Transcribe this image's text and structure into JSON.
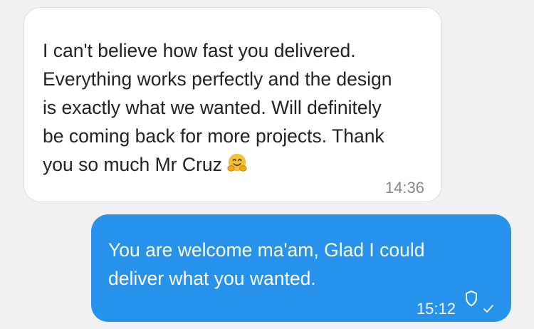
{
  "colors": {
    "background": "#f1f1f3",
    "incoming_bubble": "#ffffff",
    "outgoing_bubble": "#2792ec",
    "incoming_text": "#222222",
    "outgoing_text": "#ffffff",
    "timestamp_incoming": "#888888"
  },
  "messages": [
    {
      "direction": "incoming",
      "lines": [
        "I can't believe how fast you delivered.",
        "Everything works perfectly and the design",
        "is exactly what we wanted. Will definitely",
        "be coming back for more projects. Thank",
        "you so much Mr Cruz"
      ],
      "emoji": "hugging-face-icon",
      "time": "14:36"
    },
    {
      "direction": "outgoing",
      "lines": [
        "You are welcome ma'am, Glad I could",
        "deliver what you wanted."
      ],
      "time": "15:12",
      "status_icons": [
        "shield-icon",
        "checkmark-icon"
      ]
    }
  ]
}
